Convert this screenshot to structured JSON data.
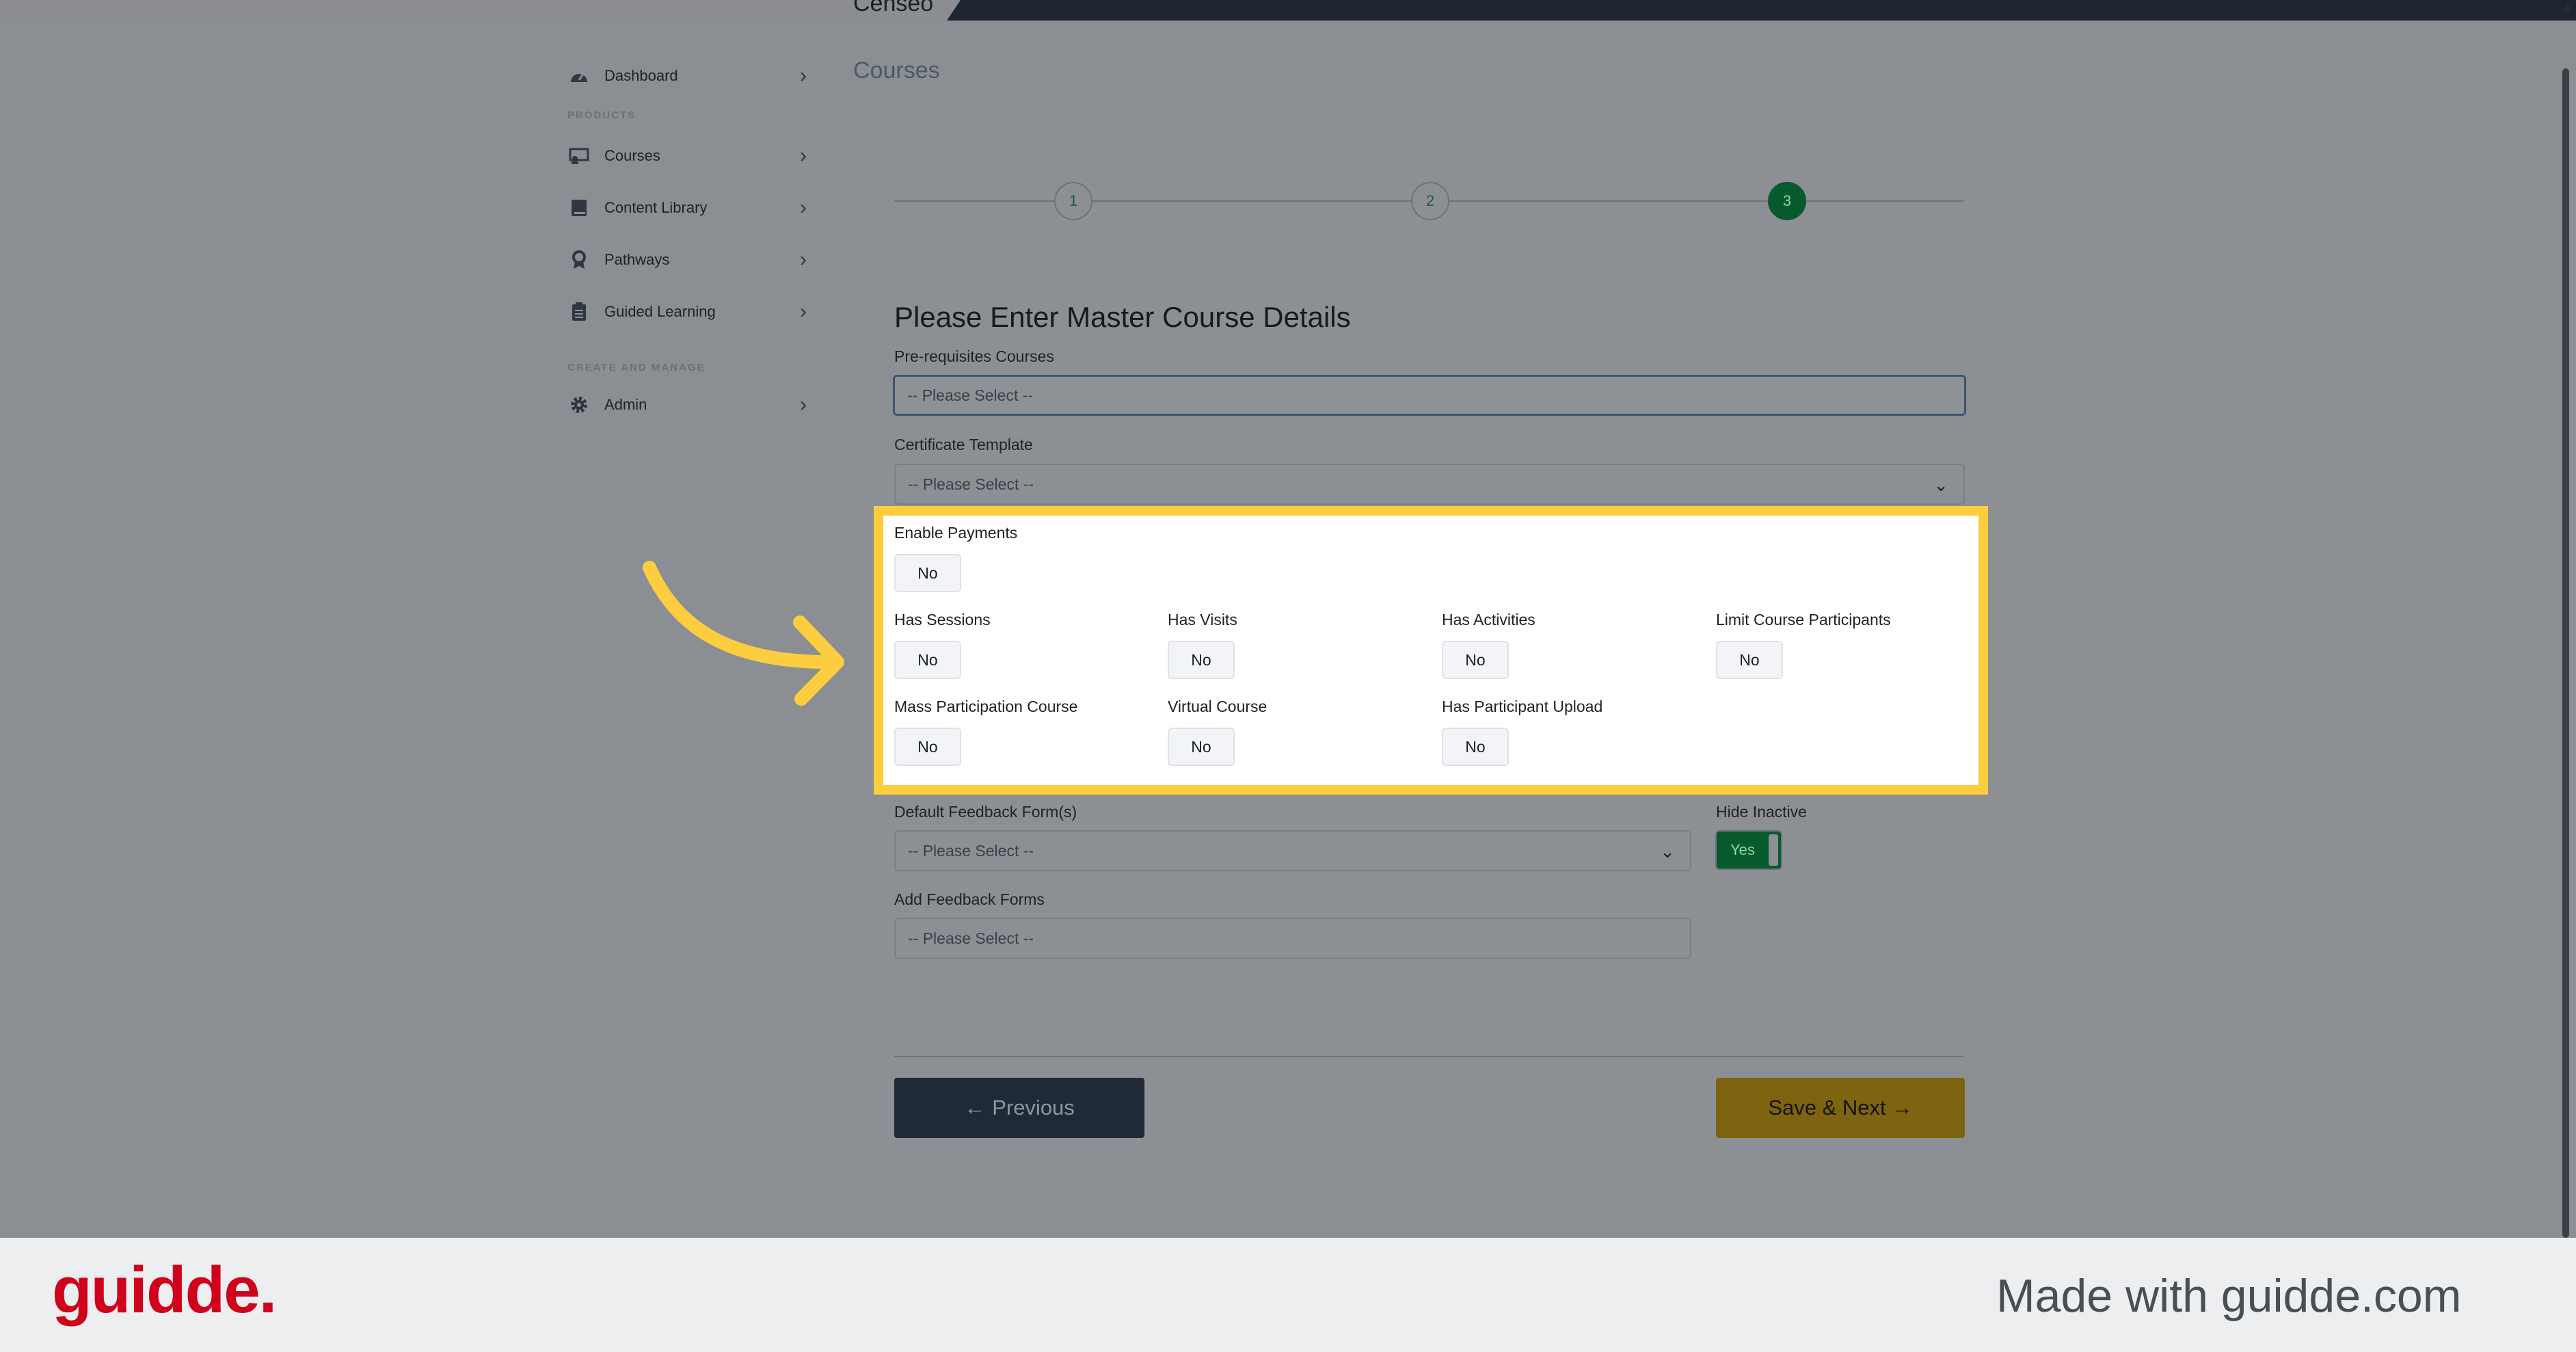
{
  "app": {
    "brand": "Censeo"
  },
  "sidebar": {
    "dashboard": "Dashboard",
    "section_products": "PRODUCTS",
    "items": [
      {
        "label": "Courses"
      },
      {
        "label": "Content Library"
      },
      {
        "label": "Pathways"
      },
      {
        "label": "Guided Learning"
      }
    ],
    "section_manage": "CREATE AND MANAGE",
    "admin": "Admin"
  },
  "page": {
    "title": "Courses"
  },
  "stepper": {
    "steps": [
      "1",
      "2",
      "3"
    ],
    "active_step": 3
  },
  "form": {
    "heading": "Please Enter Master Course Details",
    "prereq": {
      "label": "Pre-requisites Courses",
      "placeholder": "-- Please Select --"
    },
    "certificate": {
      "label": "Certificate Template",
      "value": "-- Please Select --"
    },
    "toggles": {
      "enable_payments": {
        "label": "Enable Payments",
        "value": "No"
      },
      "has_sessions": {
        "label": "Has Sessions",
        "value": "No"
      },
      "has_visits": {
        "label": "Has Visits",
        "value": "No"
      },
      "has_activities": {
        "label": "Has Activities",
        "value": "No"
      },
      "limit_participants": {
        "label": "Limit Course Participants",
        "value": "No"
      },
      "mass_participation": {
        "label": "Mass Participation Course",
        "value": "No"
      },
      "virtual_course": {
        "label": "Virtual Course",
        "value": "No"
      },
      "participant_upload": {
        "label": "Has Participant Upload",
        "value": "No"
      }
    },
    "default_feedback": {
      "label": "Default Feedback Form(s)",
      "value": "-- Please Select --"
    },
    "hide_inactive": {
      "label": "Hide Inactive",
      "value": "Yes"
    },
    "add_feedback": {
      "label": "Add Feedback Forms",
      "placeholder": "-- Please Select --"
    },
    "previous_label": "Previous",
    "next_label": "Save & Next"
  },
  "footer": {
    "logo": "guidde.",
    "tagline": "Made with guidde.com"
  },
  "colors": {
    "highlight": "#fbcd3f",
    "success": "#075a2e",
    "primary_button": "#7e6410"
  }
}
